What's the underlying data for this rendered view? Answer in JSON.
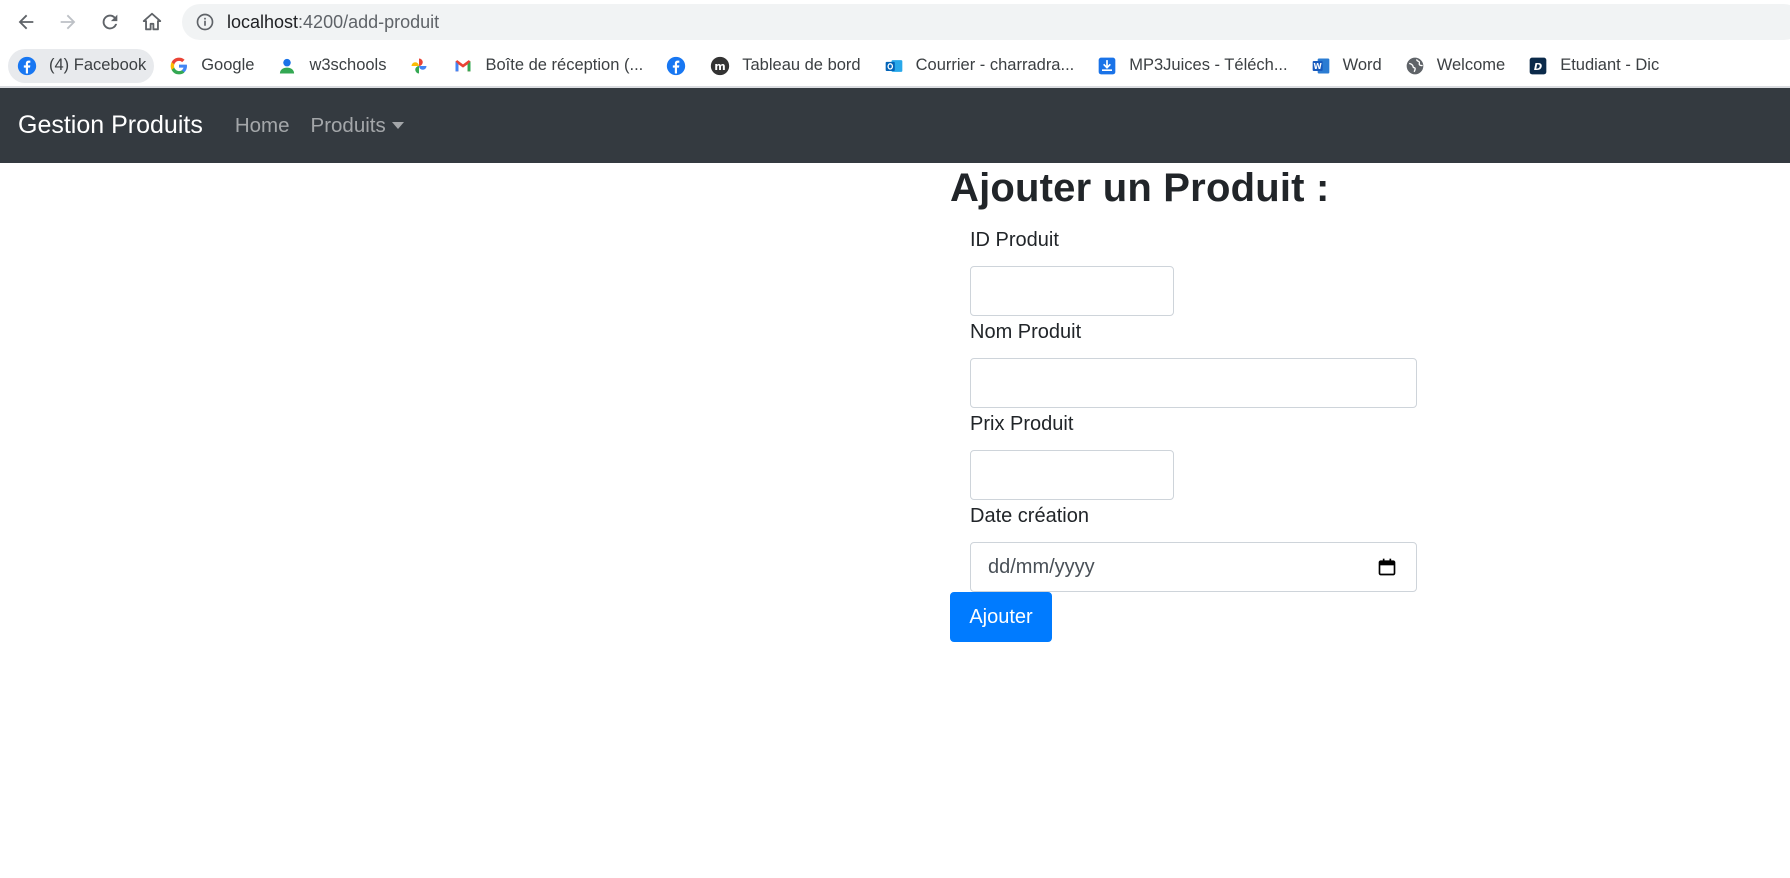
{
  "browser": {
    "url_host": "localhost",
    "url_path": ":4200/add-produit",
    "bookmarks": [
      {
        "label": "(4) Facebook",
        "icon": "facebook-icon"
      },
      {
        "label": "Google",
        "icon": "google-icon"
      },
      {
        "label": "w3schools",
        "icon": "person-icon"
      },
      {
        "label": "",
        "icon": "pinwheel-icon"
      },
      {
        "label": "Boîte de réception (...",
        "icon": "gmail-icon"
      },
      {
        "label": "",
        "icon": "facebook-icon"
      },
      {
        "label": "Tableau de bord",
        "icon": "moodle-icon"
      },
      {
        "label": "Courrier - charradra...",
        "icon": "outlook-icon"
      },
      {
        "label": "MP3Juices - Téléch...",
        "icon": "download-icon"
      },
      {
        "label": "Word",
        "icon": "word-icon"
      },
      {
        "label": "Welcome",
        "icon": "globe-icon"
      },
      {
        "label": "Etudiant - Dic",
        "icon": "app-icon"
      }
    ]
  },
  "navbar": {
    "brand": "Gestion Produits",
    "links": [
      "Home",
      "Produits"
    ]
  },
  "form": {
    "title": "Ajouter un Produit :",
    "fields": [
      {
        "label": "ID Produit",
        "value": ""
      },
      {
        "label": "Nom Produit",
        "value": ""
      },
      {
        "label": "Prix Produit",
        "value": ""
      },
      {
        "label": "Date création",
        "placeholder": "dd/mm/yyyy"
      }
    ],
    "submit_label": "Ajouter"
  },
  "colors": {
    "navbar_bg": "#343a40",
    "primary": "#007bff",
    "facebook": "#1877f2"
  }
}
